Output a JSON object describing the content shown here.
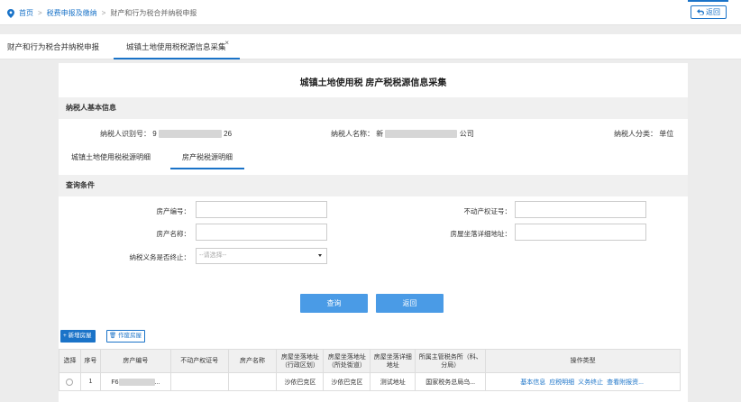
{
  "breadcrumb": {
    "home": "首页",
    "level2": "税费申报及缴纳",
    "current": "财产和行为税合并纳税申报",
    "back_label": "返回"
  },
  "tabs": [
    {
      "label": "财产和行为税合并纳税申报"
    },
    {
      "label": "城镇土地使用税税源信息采集",
      "close": "×"
    }
  ],
  "page_title": "城镇土地使用税 房产税税源信息采集",
  "taxpayer": {
    "section_title": "纳税人基本信息",
    "id_label": "纳税人识别号：",
    "id_prefix": "9",
    "id_suffix": "26",
    "name_label": "纳税人名称：",
    "name_prefix": "新",
    "name_suffix": "公司",
    "type_label": "纳税人分类：",
    "type_value": "单位"
  },
  "subtabs": [
    {
      "label": "城镇土地使用税税源明细"
    },
    {
      "label": "房产税税源明细"
    }
  ],
  "query": {
    "section_title": "查询条件",
    "property_no_label": "房产编号：",
    "cert_no_label": "不动产权证号：",
    "property_name_label": "房产名称：",
    "address_label": "房屋坐落详细地址：",
    "terminated_label": "纳税义务是否终止：",
    "terminated_placeholder": "--请选择--",
    "search_label": "查询",
    "back_label": "返回"
  },
  "actions": {
    "add_label": "新增房屋",
    "void_label": "作废房屋"
  },
  "table": {
    "headers": [
      "选择",
      "序号",
      "房产编号",
      "不动产权证号",
      "房产名称",
      "房屋坐落地址（行政区划）",
      "房屋坐落地址（所处街道）",
      "房屋坐落详细地址",
      "所属主管税务所（科、分局）",
      "操作类型"
    ],
    "rows": [
      {
        "index": "1",
        "property_no_prefix": "F6",
        "property_no_suffix": "...",
        "cert_no": "",
        "property_name": "",
        "district": "沙依巴克区",
        "street": "沙依巴克区",
        "address": "测试地址",
        "office": "国家税务总局乌...",
        "ops": [
          "基本信息",
          "应税明细",
          "义务终止",
          "查看附报资..."
        ]
      }
    ]
  },
  "colors": {
    "accent": "#1a73c8",
    "button": "#4a9be6",
    "section_bg": "#f0f0f0"
  }
}
